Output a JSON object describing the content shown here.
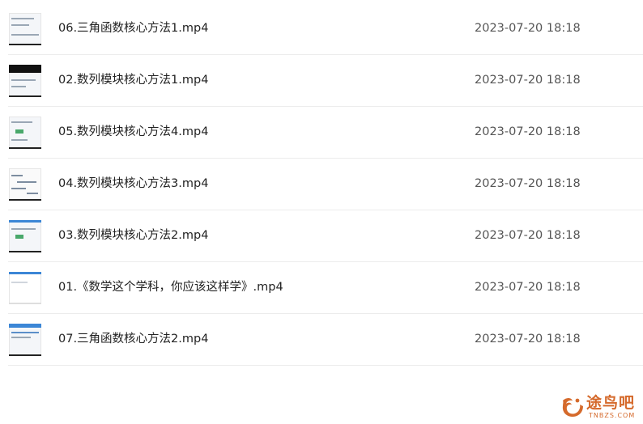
{
  "files": [
    {
      "name": "06.三角函数核心方法1.mp4",
      "modified": "2023-07-20 18:18",
      "thumb": "math-slide-thumbnail"
    },
    {
      "name": "02.数列模块核心方法1.mp4",
      "modified": "2023-07-20 18:18",
      "thumb": "dark-header-thumbnail"
    },
    {
      "name": "05.数列模块核心方法4.mp4",
      "modified": "2023-07-20 18:18",
      "thumb": "math-slide-thumbnail"
    },
    {
      "name": "04.数列模块核心方法3.mp4",
      "modified": "2023-07-20 18:18",
      "thumb": "whiteboard-thumbnail"
    },
    {
      "name": "03.数列模块核心方法2.mp4",
      "modified": "2023-07-20 18:18",
      "thumb": "blue-header-thumbnail"
    },
    {
      "name": "01.《数学这个学科，你应该这样学》.mp4",
      "modified": "2023-07-20 18:18",
      "thumb": "blue-header-thumbnail"
    },
    {
      "name": "07.三角函数核心方法2.mp4",
      "modified": "2023-07-20 18:18",
      "thumb": "blue-header-thumbnail"
    }
  ],
  "watermark": {
    "text": "途鸟吧",
    "subtext": "TNBZS.COM",
    "color": "#d56a2c"
  }
}
